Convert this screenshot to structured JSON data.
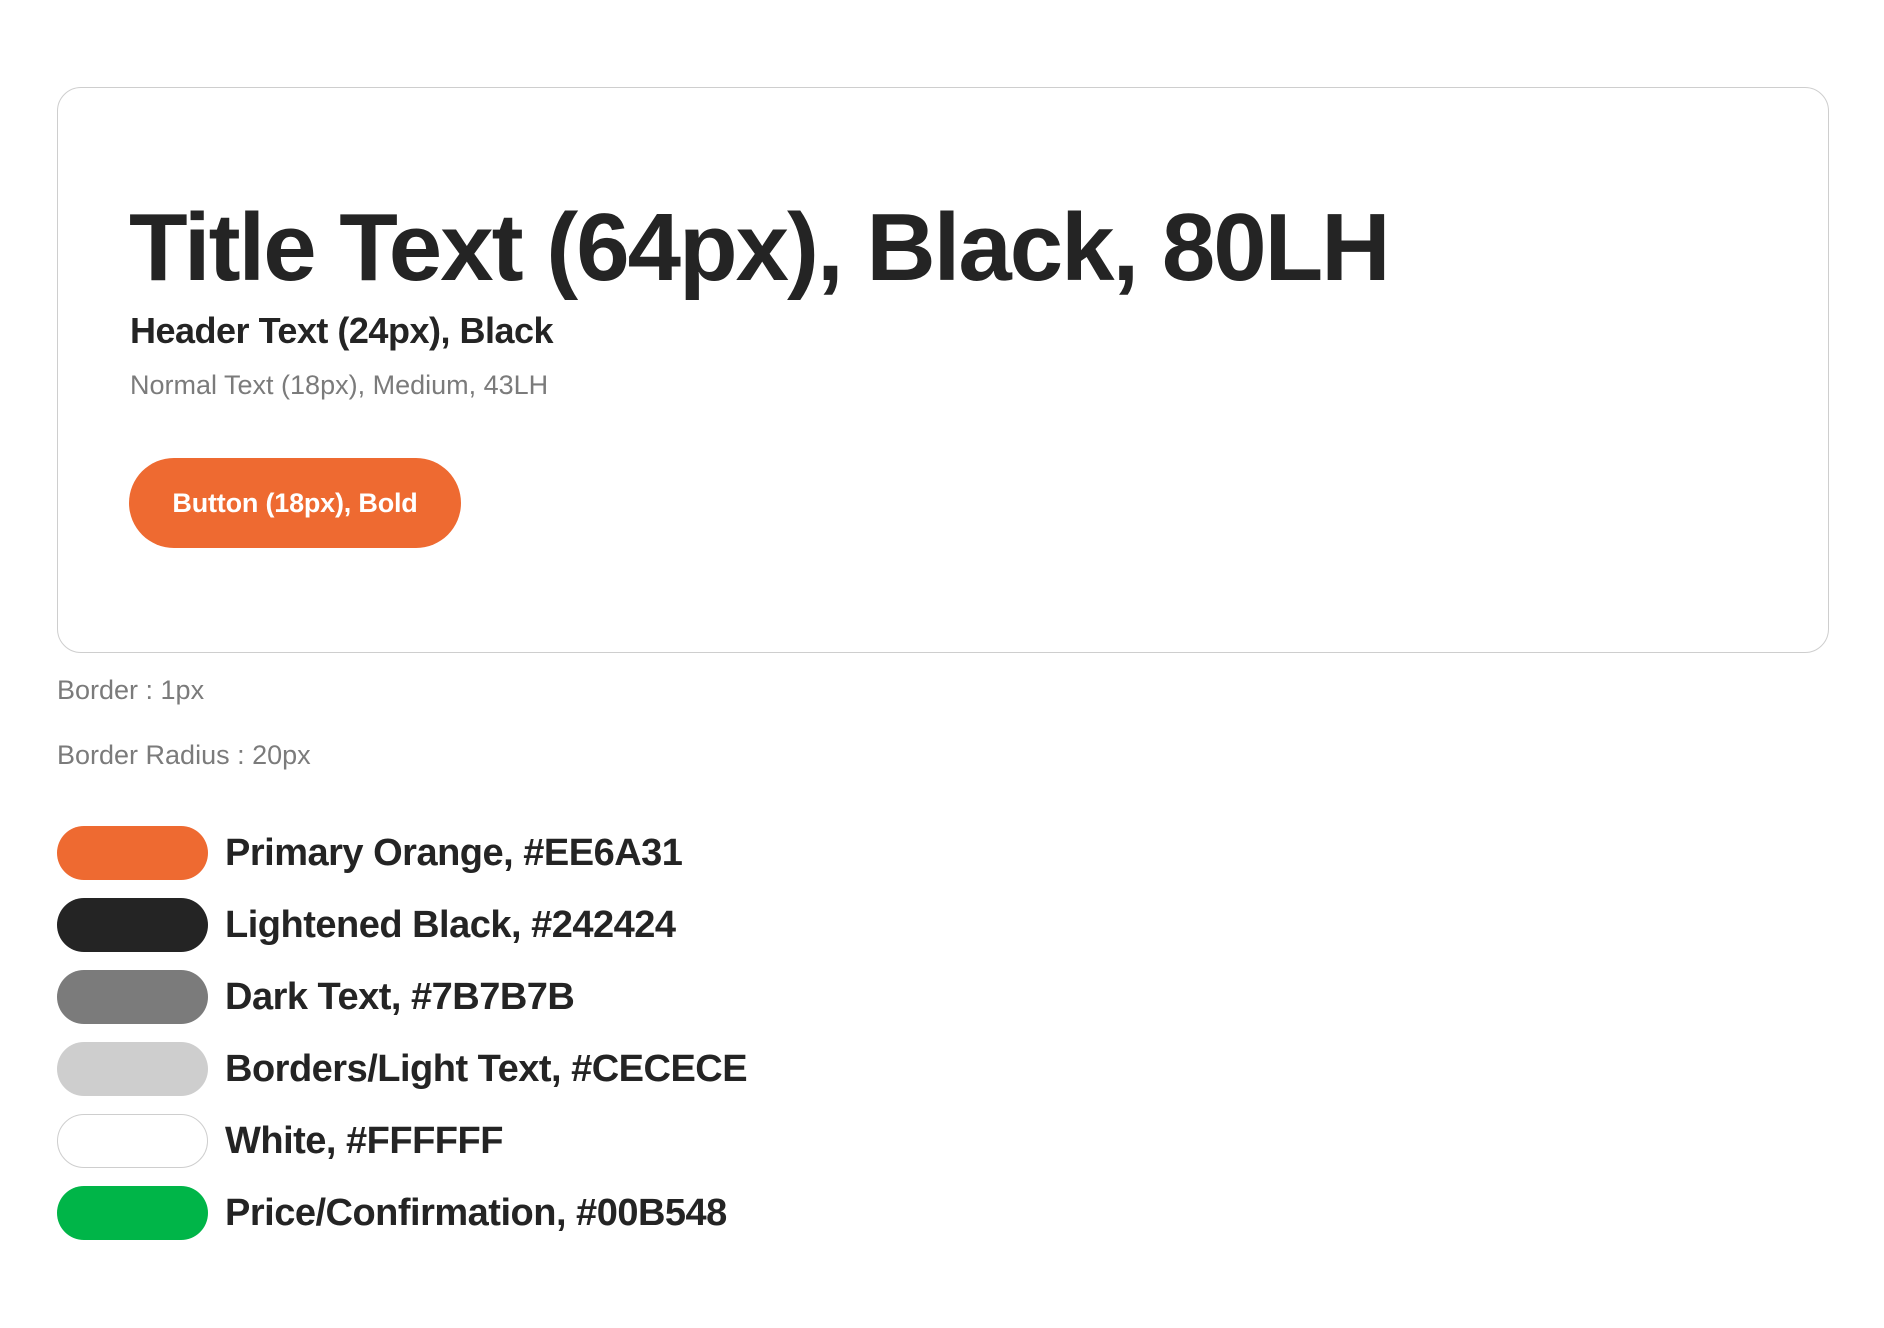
{
  "card": {
    "title": "Title Text (64px), Black, 80LH",
    "header": "Header Text (24px), Black",
    "normal": "Normal Text (18px), Medium, 43LH",
    "button_label": "Button (18px), Bold"
  },
  "notes": {
    "border": "Border : 1px",
    "border_radius": "Border Radius : 20px"
  },
  "swatches": [
    {
      "label": "Primary Orange, #EE6A31",
      "color": "#EE6A31"
    },
    {
      "label": "Lightened Black, #242424",
      "color": "#242424"
    },
    {
      "label": "Dark Text, #7B7B7B",
      "color": "#7B7B7B"
    },
    {
      "label": "Borders/Light Text, #CECECE",
      "color": "#CECECE"
    },
    {
      "label": "White, #FFFFFF",
      "color": "#FFFFFF"
    },
    {
      "label": "Price/Confirmation, #00B548",
      "color": "#00B548"
    }
  ]
}
